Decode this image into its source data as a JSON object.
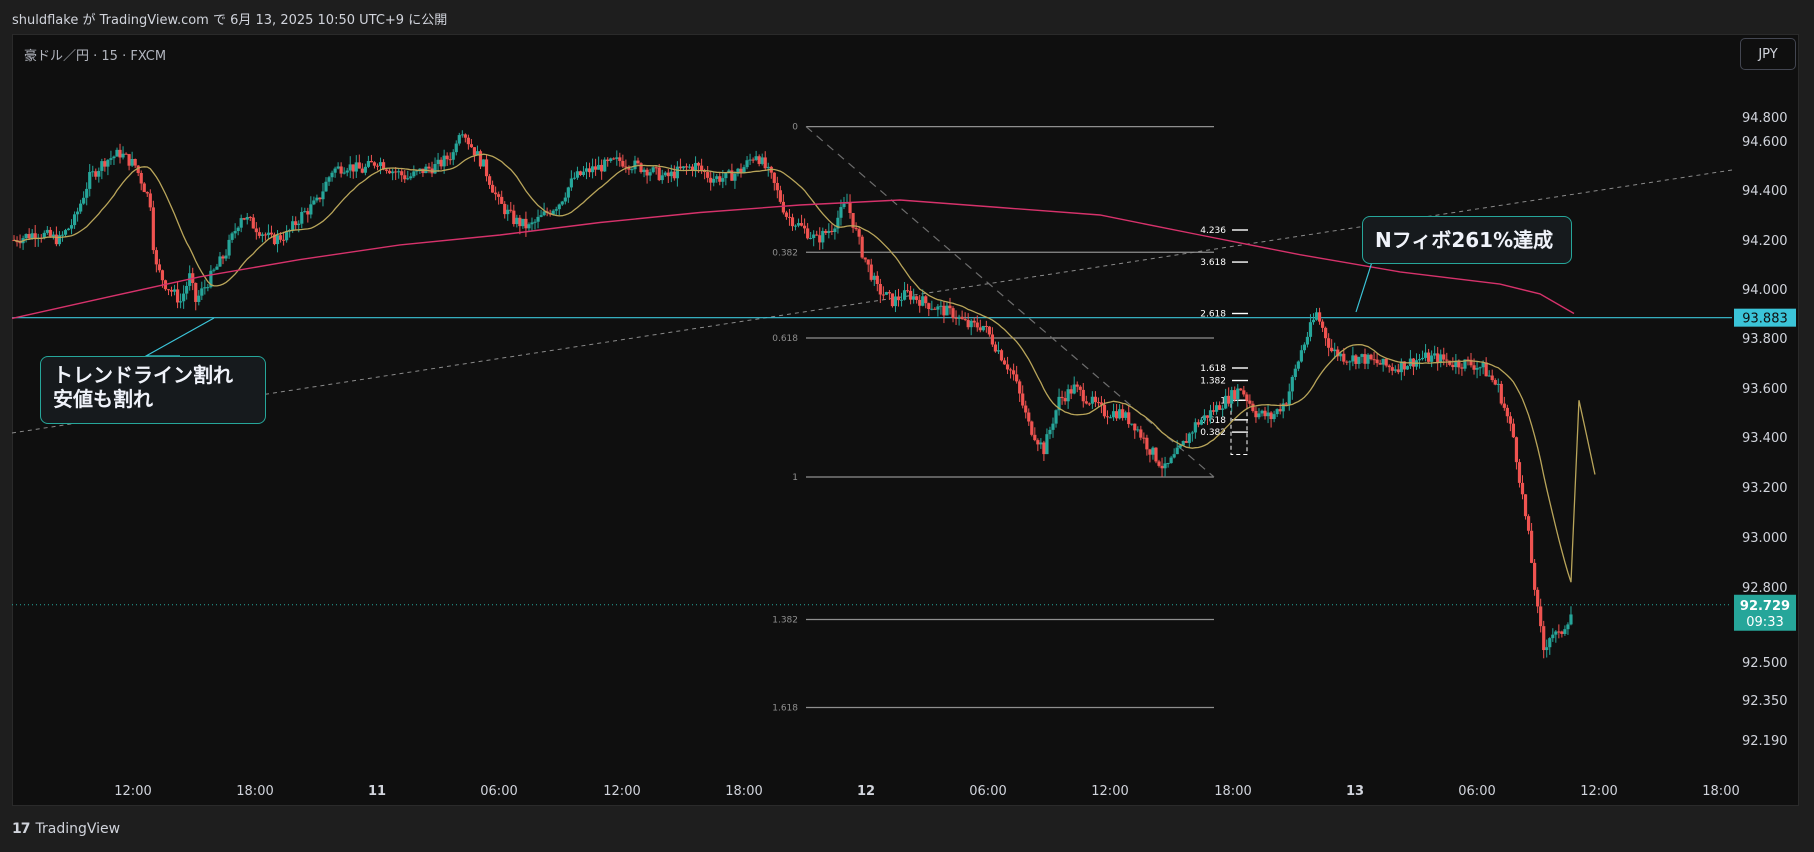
{
  "header": {
    "publish_text": "shuldflake が TradingView.com で 6月 13, 2025 10:50 UTC+9 に公開"
  },
  "symbol": {
    "label": "豪ドル／円 · 15 · FXCM"
  },
  "currency_button": {
    "label": "JPY"
  },
  "footer": {
    "logo_text": "TradingView",
    "logo_mark": "17"
  },
  "annotations": {
    "trendline_break": {
      "line1": "トレンドライン割れ",
      "line2": "安値も割れ"
    },
    "n_fibo": {
      "text": "Nフィボ261%達成"
    }
  },
  "colors": {
    "bull": "#26a69a",
    "bear": "#ef5350",
    "ma_fast": "#b9a55a",
    "ma_slow": "#d6326b",
    "hline": "#3bc4d8",
    "fib": "#6d6d6d"
  },
  "chart_data": {
    "type": "candlestick",
    "y_axis": {
      "min": 92.1,
      "max": 94.9,
      "ticks": [
        "94.800",
        "94.600",
        "94.400",
        "94.200",
        "94.000",
        "93.800",
        "93.600",
        "93.400",
        "93.200",
        "93.000",
        "92.800",
        "92.500",
        "92.350",
        "92.190"
      ]
    },
    "x_axis": {
      "tick_labels": [
        "12:00",
        "18:00",
        "11",
        "06:00",
        "12:00",
        "18:00",
        "12",
        "06:00",
        "12:00",
        "18:00",
        "13",
        "06:00",
        "12:00",
        "18:00"
      ]
    },
    "price_labels": {
      "horizontal_level": "93.883",
      "last_price": "92.729",
      "countdown": "09:33"
    },
    "horizontal_level_value": 93.883,
    "last_price_value": 92.729,
    "trendline": {
      "from": 93.4,
      "to": 94.48
    },
    "fib_retracement": {
      "from": 94.72,
      "to": 93.24,
      "levels": [
        {
          "label": "0",
          "value": 94.72
        },
        {
          "label": "0.382",
          "value": 94.15
        },
        {
          "label": "0.618",
          "value": 93.8
        },
        {
          "label": "1",
          "value": 93.24
        },
        {
          "label": "1.382",
          "value": 92.67
        },
        {
          "label": "1.618",
          "value": 92.32
        }
      ]
    },
    "fib_extension": {
      "levels": [
        {
          "label": "4.236",
          "value": 94.24
        },
        {
          "label": "3.618",
          "value": 94.11
        },
        {
          "label": "2.618",
          "value": 93.9
        },
        {
          "label": "1.618",
          "value": 93.68
        },
        {
          "label": "1.382",
          "value": 93.63
        },
        {
          "label": "1",
          "value": 93.55
        },
        {
          "label": "0.618",
          "value": 93.47
        },
        {
          "label": "0.382",
          "value": 93.42
        }
      ]
    },
    "close_path": [
      [
        0,
        94.2
      ],
      [
        1.5,
        94.23
      ],
      [
        3,
        94.2
      ],
      [
        4,
        94.28
      ],
      [
        5,
        94.45
      ],
      [
        6,
        94.52
      ],
      [
        7,
        94.55
      ],
      [
        8,
        94.5
      ],
      [
        9,
        94.35
      ],
      [
        9.3,
        94.1
      ],
      [
        10,
        94.02
      ],
      [
        11,
        93.95
      ],
      [
        11.6,
        94.05
      ],
      [
        12,
        93.95
      ],
      [
        13,
        94.05
      ],
      [
        14,
        94.15
      ],
      [
        15,
        94.3
      ],
      [
        16,
        94.25
      ],
      [
        17,
        94.2
      ],
      [
        18,
        94.22
      ],
      [
        19,
        94.3
      ],
      [
        20,
        94.35
      ],
      [
        21,
        94.48
      ],
      [
        22,
        94.5
      ],
      [
        23,
        94.48
      ],
      [
        24,
        94.52
      ],
      [
        25,
        94.48
      ],
      [
        26,
        94.45
      ],
      [
        27,
        94.48
      ],
      [
        28,
        94.5
      ],
      [
        29,
        94.55
      ],
      [
        29.5,
        94.7
      ],
      [
        30,
        94.6
      ],
      [
        31,
        94.5
      ],
      [
        32,
        94.35
      ],
      [
        33,
        94.28
      ],
      [
        34,
        94.25
      ],
      [
        35,
        94.3
      ],
      [
        36,
        94.35
      ],
      [
        37,
        94.45
      ],
      [
        38,
        94.48
      ],
      [
        39,
        94.5
      ],
      [
        40,
        94.52
      ],
      [
        41,
        94.5
      ],
      [
        42,
        94.48
      ],
      [
        43,
        94.45
      ],
      [
        44,
        94.48
      ],
      [
        45,
        94.5
      ],
      [
        46,
        94.45
      ],
      [
        47,
        94.45
      ],
      [
        48,
        94.48
      ],
      [
        49,
        94.55
      ],
      [
        50,
        94.45
      ],
      [
        51,
        94.3
      ],
      [
        52,
        94.25
      ],
      [
        53,
        94.2
      ],
      [
        54,
        94.25
      ],
      [
        55,
        94.35
      ],
      [
        56,
        94.15
      ],
      [
        57,
        94.0
      ],
      [
        58,
        93.95
      ],
      [
        59,
        93.98
      ],
      [
        60,
        93.95
      ],
      [
        61,
        93.92
      ],
      [
        62,
        93.9
      ],
      [
        63,
        93.85
      ],
      [
        64,
        93.85
      ],
      [
        65,
        93.75
      ],
      [
        66,
        93.65
      ],
      [
        67,
        93.45
      ],
      [
        68,
        93.35
      ],
      [
        69,
        93.55
      ],
      [
        70,
        93.6
      ],
      [
        71,
        93.55
      ],
      [
        72,
        93.5
      ],
      [
        73,
        93.5
      ],
      [
        74,
        93.45
      ],
      [
        75,
        93.35
      ],
      [
        76,
        93.27
      ],
      [
        77,
        93.35
      ],
      [
        78,
        93.45
      ],
      [
        79,
        93.5
      ],
      [
        80,
        93.55
      ],
      [
        81,
        93.6
      ],
      [
        82,
        93.5
      ],
      [
        83,
        93.48
      ],
      [
        84,
        93.55
      ],
      [
        85,
        93.75
      ],
      [
        86,
        93.9
      ],
      [
        87,
        93.75
      ],
      [
        88,
        93.72
      ],
      [
        89,
        93.72
      ],
      [
        90,
        93.7
      ],
      [
        91,
        93.68
      ],
      [
        92,
        93.7
      ],
      [
        93,
        93.72
      ],
      [
        94,
        93.72
      ],
      [
        95,
        93.7
      ],
      [
        96,
        93.7
      ],
      [
        97,
        93.68
      ],
      [
        98,
        93.6
      ],
      [
        99,
        93.4
      ],
      [
        100,
        93.0
      ],
      [
        100.6,
        92.7
      ],
      [
        101,
        92.55
      ],
      [
        101.5,
        92.62
      ],
      [
        102,
        92.6
      ],
      [
        103,
        92.72
      ]
    ],
    "series": [
      {
        "name": "",
        "kind": "sma_fast"
      },
      {
        "name": "",
        "kind": "sma_slow"
      }
    ]
  }
}
